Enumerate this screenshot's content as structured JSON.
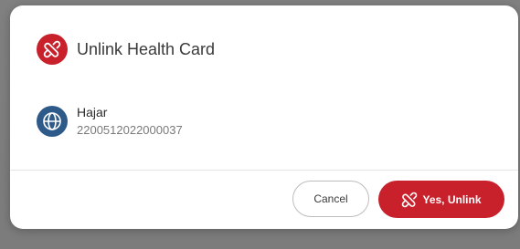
{
  "dialog": {
    "title": "Unlink Health Card",
    "icon": "unlink-icon"
  },
  "card": {
    "icon": "globe-icon",
    "name": "Hajar",
    "number": "2200512022000037"
  },
  "actions": {
    "cancel_label": "Cancel",
    "confirm_label": "Yes, Unlink",
    "confirm_icon": "unlink-icon"
  },
  "colors": {
    "accent": "#c8212c",
    "globe_bg": "#2e5a8a",
    "backdrop": "#7a7a7a"
  }
}
